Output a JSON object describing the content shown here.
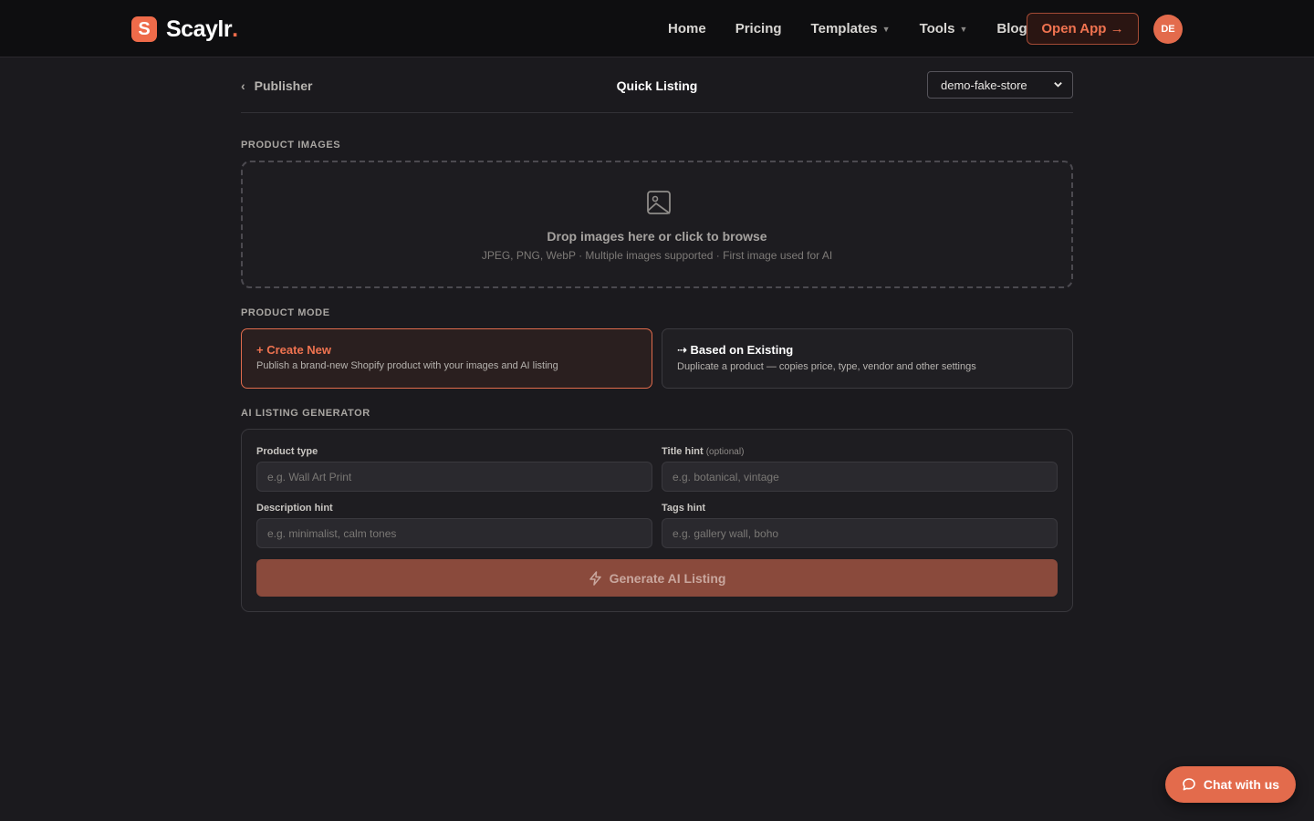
{
  "nav": {
    "brand_mark": "S",
    "brand_name": "Scaylr",
    "brand_dot": ".",
    "links": [
      {
        "label": "Home",
        "has_caret": false
      },
      {
        "label": "Pricing",
        "has_caret": false
      },
      {
        "label": "Templates",
        "has_caret": true
      },
      {
        "label": "Tools",
        "has_caret": true
      },
      {
        "label": "Blog",
        "has_caret": false
      }
    ],
    "open_app_label": "Open App →",
    "avatar_initials": "DE"
  },
  "subheader": {
    "back_label": "Publisher",
    "title": "Quick Listing",
    "store_selected": "demo-fake-store"
  },
  "product_images": {
    "section_label": "PRODUCT IMAGES",
    "drop_title": "Drop images here or click to browse",
    "drop_subtitle": "JPEG, PNG, WebP · Multiple images supported · First image used for AI"
  },
  "product_mode": {
    "section_label": "PRODUCT MODE",
    "options": [
      {
        "title": "+ Create New",
        "description": "Publish a brand-new Shopify product with your images and AI listing",
        "selected": true
      },
      {
        "title": "⇢ Based on Existing",
        "description": "Duplicate a product — copies price, type, vendor and other settings",
        "selected": false
      }
    ]
  },
  "ai_generator": {
    "section_label": "AI LISTING GENERATOR",
    "fields": {
      "product_type": {
        "label": "Product type",
        "placeholder": "e.g. Wall Art Print"
      },
      "title_hint": {
        "label": "Title hint",
        "optional": "(optional)",
        "placeholder": "e.g. botanical, vintage"
      },
      "description_hint": {
        "label": "Description hint",
        "placeholder": "e.g. minimalist, calm tones"
      },
      "tags_hint": {
        "label": "Tags hint",
        "placeholder": "e.g. gallery wall, boho"
      }
    },
    "generate_label": "Generate AI Listing"
  },
  "chat": {
    "label": "Chat with us"
  },
  "colors": {
    "accent": "#e36b4c",
    "background": "#1b1a1e",
    "nav_background": "#0e0e10"
  },
  "icons": {
    "dropzone": "image-icon",
    "generate": "lightning-icon",
    "chat": "chat-bubble-icon",
    "back": "chevron-left-icon"
  }
}
